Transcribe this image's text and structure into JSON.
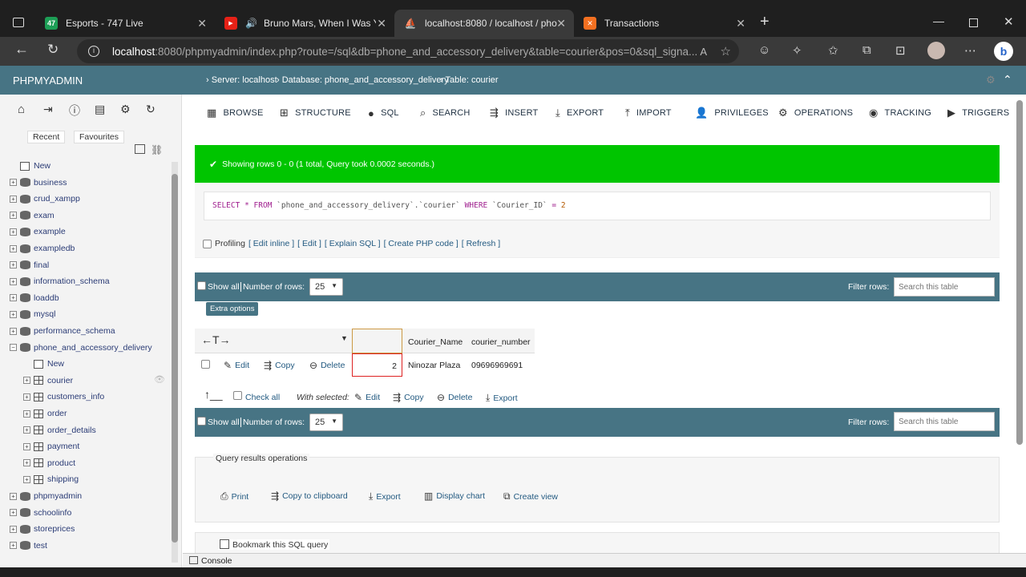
{
  "browser": {
    "tabs": [
      {
        "title": "Esports - 747 Live",
        "fav_text": "47",
        "fav_color": "#1d9e56"
      },
      {
        "title": "Bruno Mars, When I Was Yo",
        "fav_text": "▶",
        "fav_color": "#e62117"
      },
      {
        "title": "localhost:8080 / localhost / phon",
        "fav_text": "⛵",
        "fav_color": "#c47f21"
      },
      {
        "title": "Transactions",
        "fav_text": "✕",
        "fav_color": "#f37021"
      }
    ],
    "url_host": "localhost",
    "url_rest": ":8080/phpmyadmin/index.php?route=/sql&db=phone_and_accessory_delivery&table=courier&pos=0&sql_signa..."
  },
  "nav": {
    "brand": "PHPMYADMIN",
    "recent": "Recent",
    "favourites": "Favourites",
    "tree": [
      {
        "label": "New",
        "level": 0,
        "kind": "new"
      },
      {
        "label": "business",
        "level": 0,
        "kind": "db"
      },
      {
        "label": "crud_xampp",
        "level": 0,
        "kind": "db"
      },
      {
        "label": "exam",
        "level": 0,
        "kind": "db"
      },
      {
        "label": "example",
        "level": 0,
        "kind": "db"
      },
      {
        "label": "exampledb",
        "level": 0,
        "kind": "db"
      },
      {
        "label": "final",
        "level": 0,
        "kind": "db"
      },
      {
        "label": "information_schema",
        "level": 0,
        "kind": "db"
      },
      {
        "label": "loaddb",
        "level": 0,
        "kind": "db"
      },
      {
        "label": "mysql",
        "level": 0,
        "kind": "db"
      },
      {
        "label": "performance_schema",
        "level": 0,
        "kind": "db"
      },
      {
        "label": "phone_and_accessory_delivery",
        "level": 0,
        "kind": "db-open"
      },
      {
        "label": "New",
        "level": 1,
        "kind": "new"
      },
      {
        "label": "courier",
        "level": 1,
        "kind": "table"
      },
      {
        "label": "customers_info",
        "level": 1,
        "kind": "table"
      },
      {
        "label": "order",
        "level": 1,
        "kind": "table"
      },
      {
        "label": "order_details",
        "level": 1,
        "kind": "table"
      },
      {
        "label": "payment",
        "level": 1,
        "kind": "table"
      },
      {
        "label": "product",
        "level": 1,
        "kind": "table"
      },
      {
        "label": "shipping",
        "level": 1,
        "kind": "table"
      },
      {
        "label": "phpmyadmin",
        "level": 0,
        "kind": "db"
      },
      {
        "label": "schoolinfo",
        "level": 0,
        "kind": "db"
      },
      {
        "label": "storeprices",
        "level": 0,
        "kind": "db"
      },
      {
        "label": "test",
        "level": 0,
        "kind": "db"
      }
    ]
  },
  "breadcrumb": {
    "server": "Server: localhost",
    "database": "Database: phone_and_accessory_delivery",
    "table": "Table: courier"
  },
  "menu": [
    {
      "label": "Browse",
      "icon": "browse-icon",
      "glyph": "▦"
    },
    {
      "label": "Structure",
      "icon": "structure-icon",
      "glyph": "⊞"
    },
    {
      "label": "SQL",
      "icon": "sql-icon",
      "glyph": "●"
    },
    {
      "label": "Search",
      "icon": "search-icon",
      "glyph": "⌕"
    },
    {
      "label": "Insert",
      "icon": "insert-icon",
      "glyph": "⇶"
    },
    {
      "label": "Export",
      "icon": "export-icon",
      "glyph": "⤓"
    },
    {
      "label": "Import",
      "icon": "import-icon",
      "glyph": "⤒"
    },
    {
      "label": "Privileges",
      "icon": "privileges-icon",
      "glyph": "👤"
    },
    {
      "label": "Operations",
      "icon": "operations-icon",
      "glyph": "⚙"
    },
    {
      "label": "Tracking",
      "icon": "tracking-icon",
      "glyph": "◉"
    },
    {
      "label": "Triggers",
      "icon": "triggers-icon",
      "glyph": "▶"
    }
  ],
  "status": {
    "message": "Showing rows 0 - 0 (1 total, Query took 0.0002 seconds.)",
    "color": "#00c500"
  },
  "query": {
    "kw_select": "SELECT",
    "star": "*",
    "kw_from": "FROM",
    "table_ref": "`phone_and_accessory_delivery`.`courier`",
    "kw_where": "WHERE",
    "column": "`Courier_ID`",
    "op": "=",
    "value": "2"
  },
  "query_links": {
    "profiling": "Profiling",
    "edit_inline": "[ Edit inline ]",
    "edit": "[ Edit ]",
    "explain": "[ Explain SQL ]",
    "create_php": "[ Create PHP code ]",
    "refresh": "[ Refresh ]"
  },
  "nav_bar": {
    "show_all": "Show all",
    "rows_label": "Number of rows:",
    "rows_value": "25",
    "filter_label": "Filter rows:",
    "filter_placeholder": "Search this table"
  },
  "extra_options": "Extra options",
  "results": {
    "columns": [
      "Courier_Name",
      "courier_number"
    ],
    "rows": [
      {
        "id": "2",
        "name": "Ninozar Plaza",
        "number": "09696969691"
      }
    ],
    "edit": "Edit",
    "copy": "Copy",
    "delete": "Delete"
  },
  "bulk": {
    "check_all": "Check all",
    "with_selected": "With selected:",
    "edit": "Edit",
    "copy": "Copy",
    "delete": "Delete",
    "export": "Export"
  },
  "ops": {
    "title": "Query results operations",
    "print": "Print",
    "clipboard": "Copy to clipboard",
    "export": "Export",
    "chart": "Display chart",
    "view": "Create view"
  },
  "bookmark": "Bookmark this SQL query",
  "console": "Console"
}
